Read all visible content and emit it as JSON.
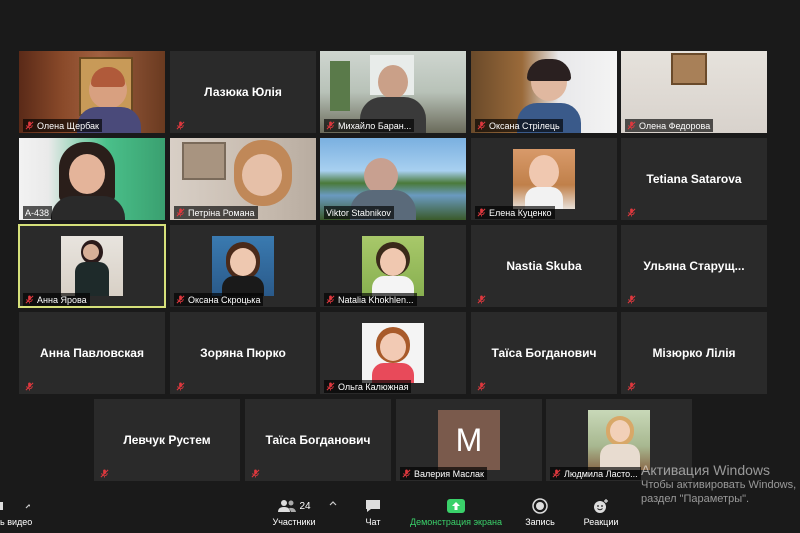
{
  "participants": [
    {
      "name": "Олена Щербак"
    },
    {
      "name": "Лазюка Юлія"
    },
    {
      "name": "Михайло Баран..."
    },
    {
      "name": "Оксана Стрілець"
    },
    {
      "name": "Олена Федорова"
    },
    {
      "name": "A-438"
    },
    {
      "name": "Петріна Романа"
    },
    {
      "name": "Viktor Stabnikov"
    },
    {
      "name": "Елена Куценко"
    },
    {
      "name": "Tetiana Satarova"
    },
    {
      "name": "Анна Ярова"
    },
    {
      "name": "Оксана Скроцька"
    },
    {
      "name": "Natalia Khokhlen..."
    },
    {
      "name": "Nastia Skuba"
    },
    {
      "name": "Ульяна  Старущ..."
    },
    {
      "name": "Анна Павловская"
    },
    {
      "name": "Зоряна Пюрко"
    },
    {
      "name": "Ольга Калюжная"
    },
    {
      "name": "Таїса Богданович"
    },
    {
      "name": "Мізюрко Лілія"
    },
    {
      "name": "Левчук Рустем"
    },
    {
      "name": "Таїса Богданович"
    },
    {
      "name": "Валерия Маслак",
      "avatar_letter": "M"
    },
    {
      "name": "Людмила Ласто..."
    }
  ],
  "toolbar": {
    "video_label": "ь видео",
    "participants_label": "Участники",
    "participants_count": "24",
    "chat_label": "Чат",
    "share_label": "Демонстрация экрана",
    "record_label": "Запись",
    "reactions_label": "Реакции"
  },
  "watermark": {
    "line1": "Активация Windows",
    "line2": "Чтобы активировать Windows,",
    "line3": "раздел \"Параметры\"."
  },
  "colors": {
    "tile_bg": "#2a2a2a",
    "active_border": "#d6e07a",
    "mute_red": "#e0383e",
    "share_green": "#3ad16a"
  }
}
